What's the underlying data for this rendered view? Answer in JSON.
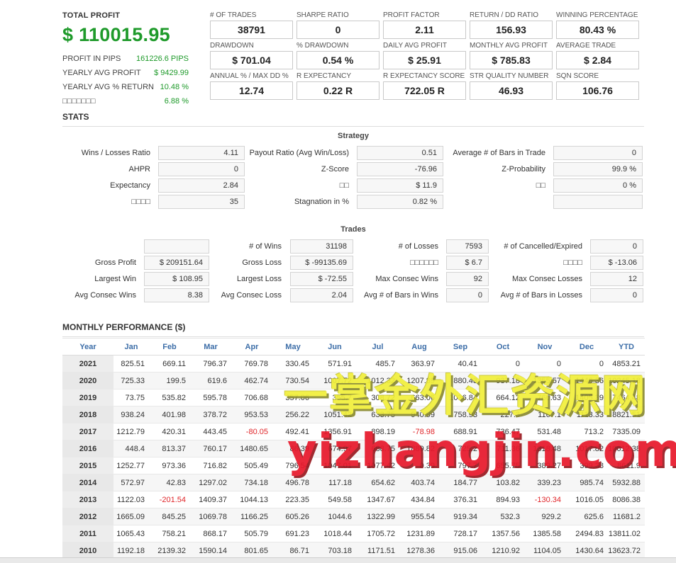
{
  "summary": {
    "total_profit_label": "TOTAL PROFIT",
    "total_profit_value": "$ 110015.95",
    "rows": [
      {
        "label": "PROFIT IN PIPS",
        "value": "161226.6 PIPS"
      },
      {
        "label": "YEARLY AVG PROFIT",
        "value": "$ 9429.99"
      },
      {
        "label": "YEARLY AVG % RETURN",
        "value": "10.48 %"
      },
      {
        "label": "□□□□□□□",
        "value": "6.88 %"
      }
    ]
  },
  "metrics": [
    [
      {
        "label": "# OF TRADES",
        "value": "38791"
      },
      {
        "label": "SHARPE RATIO",
        "value": "0"
      },
      {
        "label": "PROFIT FACTOR",
        "value": "2.11"
      },
      {
        "label": "RETURN / DD RATIO",
        "value": "156.93"
      },
      {
        "label": "WINNING PERCENTAGE",
        "value": "80.43 %"
      }
    ],
    [
      {
        "label": "DRAWDOWN",
        "value": "$ 701.04"
      },
      {
        "label": "% DRAWDOWN",
        "value": "0.54 %"
      },
      {
        "label": "DAILY AVG PROFIT",
        "value": "$ 25.91"
      },
      {
        "label": "MONTHLY AVG PROFIT",
        "value": "$ 785.83"
      },
      {
        "label": "AVERAGE TRADE",
        "value": "$ 2.84"
      }
    ],
    [
      {
        "label": "ANNUAL % / MAX DD %",
        "value": "12.74"
      },
      {
        "label": "R EXPECTANCY",
        "value": "0.22 R"
      },
      {
        "label": "R EXPECTANCY SCORE",
        "value": "722.05 R"
      },
      {
        "label": "STR QUALITY NUMBER",
        "value": "46.93"
      },
      {
        "label": "SQN SCORE",
        "value": "106.76"
      }
    ]
  ],
  "stats": {
    "title": "STATS",
    "strategy": {
      "title": "Strategy",
      "rows": [
        [
          {
            "label": "Wins / Losses Ratio",
            "value": "4.11"
          },
          {
            "label": "Payout Ratio (Avg Win/Loss)",
            "value": "0.51"
          },
          {
            "label": "Average # of Bars in Trade",
            "value": "0"
          }
        ],
        [
          {
            "label": "AHPR",
            "value": "0"
          },
          {
            "label": "Z-Score",
            "value": "-76.96"
          },
          {
            "label": "Z-Probability",
            "value": "99.9 %"
          }
        ],
        [
          {
            "label": "Expectancy",
            "value": "2.84"
          },
          {
            "label": "□□",
            "value": "$ 11.9"
          },
          {
            "label": "□□",
            "value": "0 %"
          }
        ],
        [
          {
            "label": "□□□□",
            "value": "35"
          },
          {
            "label": "Stagnation in %",
            "value": "0.82 %"
          },
          {
            "label": "",
            "value": ""
          }
        ]
      ]
    },
    "trades": {
      "title": "Trades",
      "rows": [
        [
          {
            "label": "",
            "value": ""
          },
          {
            "label": "# of Wins",
            "value": "31198"
          },
          {
            "label": "# of Losses",
            "value": "7593"
          },
          {
            "label": "# of Cancelled/Expired",
            "value": "0"
          }
        ],
        [
          {
            "label": "Gross Profit",
            "value": "$ 209151.64"
          },
          {
            "label": "Gross Loss",
            "value": "$ -99135.69"
          },
          {
            "label": "□□□□□□",
            "value": "$ 6.7"
          },
          {
            "label": "□□□□",
            "value": "$ -13.06"
          }
        ],
        [
          {
            "label": "Largest Win",
            "value": "$ 108.95"
          },
          {
            "label": "Largest Loss",
            "value": "$ -72.55"
          },
          {
            "label": "Max Consec Wins",
            "value": "92"
          },
          {
            "label": "Max Consec Losses",
            "value": "12"
          }
        ],
        [
          {
            "label": "Avg Consec Wins",
            "value": "8.38"
          },
          {
            "label": "Avg Consec Loss",
            "value": "2.04"
          },
          {
            "label": "Avg # of Bars in Wins",
            "value": "0"
          },
          {
            "label": "Avg # of Bars in Losses",
            "value": "0"
          }
        ]
      ]
    }
  },
  "monthly": {
    "title": "MONTHLY PERFORMANCE ($)",
    "headers": [
      "Year",
      "Jan",
      "Feb",
      "Mar",
      "Apr",
      "May",
      "Jun",
      "Jul",
      "Aug",
      "Sep",
      "Oct",
      "Nov",
      "Dec",
      "YTD"
    ],
    "rows": [
      [
        "2021",
        "825.51",
        "669.11",
        "796.37",
        "769.78",
        "330.45",
        "571.91",
        "485.7",
        "363.97",
        "40.41",
        "0",
        "0",
        "0",
        "4853.21"
      ],
      [
        "2020",
        "725.33",
        "199.5",
        "619.6",
        "462.74",
        "730.54",
        "1007.72",
        "1012.32",
        "1207.89",
        "880.43",
        "937.18",
        "1355.57",
        "1446.36",
        "10245.18"
      ],
      [
        "2019",
        "73.75",
        "535.82",
        "595.78",
        "706.68",
        "357.06",
        "355.7",
        "308.72",
        "663.06",
        "1036.84",
        "664.12",
        "760.63",
        "1405.39",
        "7464.48"
      ],
      [
        "2018",
        "938.24",
        "401.98",
        "378.72",
        "953.53",
        "256.22",
        "1051.42",
        "633.75",
        "940.99",
        "758.93",
        "227.3",
        "1167.1",
        "1113.33",
        "8821.51"
      ],
      [
        "2017",
        "1212.79",
        "420.31",
        "443.45",
        "-80.05",
        "492.41",
        "1356.91",
        "898.19",
        "-78.98",
        "688.91",
        "736.47",
        "531.48",
        "713.2",
        "7335.09"
      ],
      [
        "2016",
        "448.4",
        "813.37",
        "760.17",
        "1480.65",
        "86.39",
        "674.97",
        "688.75",
        "1889.82",
        "725.2",
        "711.36",
        "1318.48",
        "1017.82",
        "10612.38"
      ],
      [
        "2015",
        "1252.77",
        "973.36",
        "716.82",
        "505.49",
        "796.54",
        "1047.01",
        "1077.42",
        "0.39",
        "797.7",
        "655.75",
        "389.27",
        "399.38",
        "8611.9"
      ],
      [
        "2014",
        "572.97",
        "42.83",
        "1297.02",
        "734.18",
        "496.78",
        "117.18",
        "654.62",
        "403.74",
        "184.77",
        "103.82",
        "339.23",
        "985.74",
        "5932.88"
      ],
      [
        "2013",
        "1122.03",
        "-201.54",
        "1409.37",
        "1044.13",
        "223.35",
        "549.58",
        "1347.67",
        "434.84",
        "376.31",
        "894.93",
        "-130.34",
        "1016.05",
        "8086.38"
      ],
      [
        "2012",
        "1665.09",
        "845.25",
        "1069.78",
        "1166.25",
        "605.26",
        "1044.6",
        "1322.99",
        "955.54",
        "919.34",
        "532.3",
        "929.2",
        "625.6",
        "11681.2"
      ],
      [
        "2011",
        "1065.43",
        "758.21",
        "868.17",
        "505.79",
        "691.23",
        "1018.44",
        "1705.72",
        "1231.89",
        "728.17",
        "1357.56",
        "1385.58",
        "2494.83",
        "13811.02"
      ],
      [
        "2010",
        "1192.18",
        "2139.32",
        "1590.14",
        "801.65",
        "86.71",
        "703.18",
        "1171.51",
        "1278.36",
        "915.06",
        "1210.92",
        "1104.05",
        "1430.64",
        "13623.72"
      ]
    ]
  },
  "watermark": {
    "line1": "一掌金外汇资源网",
    "line2": "yizhangjin.com"
  },
  "colors": {
    "profit_green": "#1e9a2a",
    "negative_red": "#e0262a",
    "header_blue": "#3d6ea8"
  }
}
